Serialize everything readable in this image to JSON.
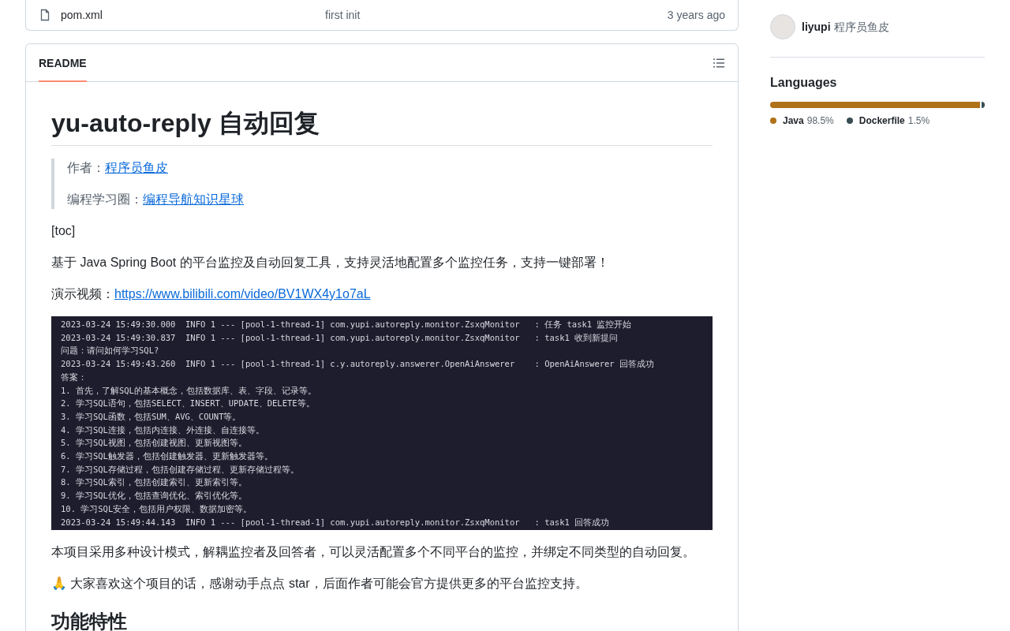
{
  "files": [
    {
      "name": "pom.xml",
      "message": "first init",
      "time": "3 years ago"
    }
  ],
  "readme": {
    "tab": "README",
    "title": "yu-auto-reply 自动回复",
    "quote": [
      {
        "label": "作者：",
        "link": "程序员鱼皮"
      },
      {
        "label": "编程学习圈：",
        "link": "编程导航知识星球"
      }
    ],
    "toc": "[toc]",
    "intro": "基于 Java Spring Boot 的平台监控及自动回复工具，支持灵活地配置多个监控任务，支持一键部署！",
    "video": {
      "label": "演示视频：",
      "link": "https://www.bilibili.com/video/BV1WX4y1o7aL"
    },
    "terminal": [
      "2023-03-24 15:49:30.000  INFO 1 --- [pool-1-thread-1] com.yupi.autoreply.monitor.ZsxqMonitor   : 任务 task1 监控开始",
      "2023-03-24 15:49:30.837  INFO 1 --- [pool-1-thread-1] com.yupi.autoreply.monitor.ZsxqMonitor   : task1 收到新提问",
      "问题：请问如何学习SQL?",
      "2023-03-24 15:49:43.260  INFO 1 --- [pool-1-thread-1] c.y.autoreply.answerer.OpenAiAnswerer    : OpenAiAnswerer 回答成功",
      "答案：",
      "1. 首先，了解SQL的基本概念，包括数据库、表、字段、记录等。",
      "2. 学习SQL语句，包括SELECT、INSERT、UPDATE、DELETE等。",
      "3. 学习SQL函数，包括SUM、AVG、COUNT等。",
      "4. 学习SQL连接，包括内连接、外连接、自连接等。",
      "5. 学习SQL视图，包括创建视图、更新视图等。",
      "6. 学习SQL触发器，包括创建触发器、更新触发器等。",
      "7. 学习SQL存储过程，包括创建存储过程、更新存储过程等。",
      "8. 学习SQL索引，包括创建索引、更新索引等。",
      "9. 学习SQL优化，包括查询优化、索引优化等。",
      "10. 学习SQL安全，包括用户权限、数据加密等。",
      "2023-03-24 15:49:44.143  INFO 1 --- [pool-1-thread-1] com.yupi.autoreply.monitor.ZsxqMonitor   : task1 回答成功"
    ],
    "paragraphs": [
      "本项目采用多种设计模式，解耦监控者及回答者，可以灵活配置多个不同平台的监控，并绑定不同类型的自动回复。",
      "🙏 大家喜欢这个项目的话，感谢动手点点 star，后面作者可能会官方提供更多的平台监控支持。"
    ],
    "heading2": "功能特性"
  },
  "contributors": [
    {
      "login": "liyupi",
      "name": "程序员鱼皮"
    }
  ],
  "languages": {
    "title": "Languages",
    "items": [
      {
        "name": "Java",
        "percent": "98.5%",
        "level": 0.985,
        "color": "#b07219"
      },
      {
        "name": "Dockerfile",
        "percent": "1.5%",
        "level": 0.015,
        "color": "#384d54"
      }
    ]
  }
}
